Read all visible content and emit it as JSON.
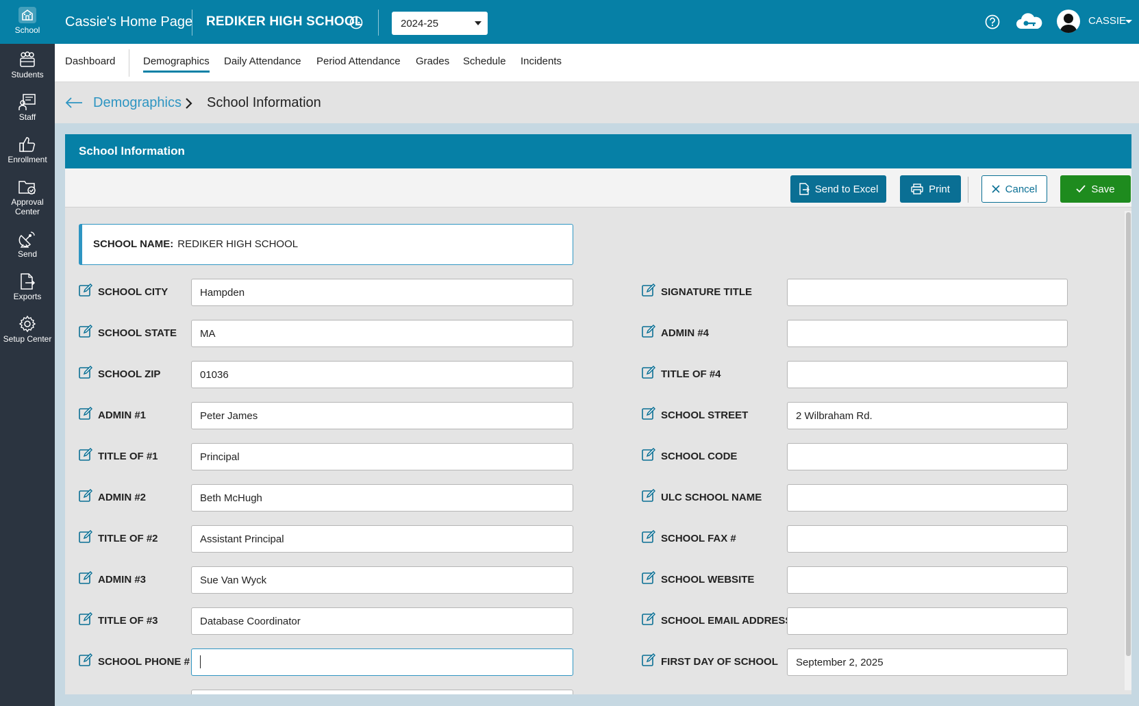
{
  "rail": {
    "items": [
      {
        "label": "School",
        "icon": "school-icon"
      },
      {
        "label": "Students",
        "icon": "students-icon"
      },
      {
        "label": "Staff",
        "icon": "staff-icon"
      },
      {
        "label": "Enrollment",
        "icon": "thumbs-up-icon"
      },
      {
        "label": "Approval Center",
        "icon": "folder-check-icon"
      },
      {
        "label": "Send",
        "icon": "satellite-icon"
      },
      {
        "label": "Exports",
        "icon": "export-file-icon"
      },
      {
        "label": "Setup Center",
        "icon": "gear-icon"
      }
    ]
  },
  "topbar": {
    "home_title": "Cassie's Home Page",
    "school_title": "REDIKER HIGH SCHOOL",
    "year": "2024-25",
    "user_name": "CASSIE"
  },
  "tabs": [
    "Dashboard",
    "Demographics",
    "Daily Attendance",
    "Period Attendance",
    "Grades",
    "Schedule",
    "Incidents"
  ],
  "active_tab": "Demographics",
  "breadcrumb": {
    "parent": "Demographics",
    "current": "School Information"
  },
  "card": {
    "title": "School Information",
    "buttons": {
      "excel": "Send to Excel",
      "print": "Print",
      "cancel": "Cancel",
      "save": "Save"
    },
    "school_name_label": "SCHOOL NAME:",
    "school_name_value": "REDIKER HIGH SCHOOL"
  },
  "left_fields": [
    {
      "label": "SCHOOL CITY",
      "value": "Hampden"
    },
    {
      "label": "SCHOOL STATE",
      "value": "MA"
    },
    {
      "label": "SCHOOL ZIP",
      "value": "01036"
    },
    {
      "label": "ADMIN #1",
      "value": "Peter James"
    },
    {
      "label": "TITLE OF #1",
      "value": "Principal"
    },
    {
      "label": "ADMIN #2",
      "value": "Beth McHugh"
    },
    {
      "label": "TITLE OF #2",
      "value": "Assistant Principal"
    },
    {
      "label": "ADMIN #3",
      "value": "Sue Van Wyck"
    },
    {
      "label": "TITLE OF #3",
      "value": "Database Coordinator"
    },
    {
      "label": "SCHOOL PHONE #",
      "value": ""
    }
  ],
  "right_fields": [
    {
      "label": "SIGNATURE TITLE",
      "value": ""
    },
    {
      "label": "ADMIN #4",
      "value": ""
    },
    {
      "label": "TITLE OF #4",
      "value": ""
    },
    {
      "label": "SCHOOL STREET",
      "value": "2 Wilbraham Rd."
    },
    {
      "label": "SCHOOL CODE",
      "value": ""
    },
    {
      "label": "ULC SCHOOL NAME",
      "value": ""
    },
    {
      "label": "SCHOOL FAX #",
      "value": ""
    },
    {
      "label": "SCHOOL WEBSITE",
      "value": ""
    },
    {
      "label": "SCHOOL EMAIL ADDRESS",
      "value": ""
    },
    {
      "label": "FIRST DAY OF SCHOOL",
      "value": "September 2, 2025"
    }
  ],
  "colors": {
    "brand": "#0680a6",
    "rail": "#2b3440",
    "save": "#1e8b1e",
    "link": "#2e95c2"
  }
}
